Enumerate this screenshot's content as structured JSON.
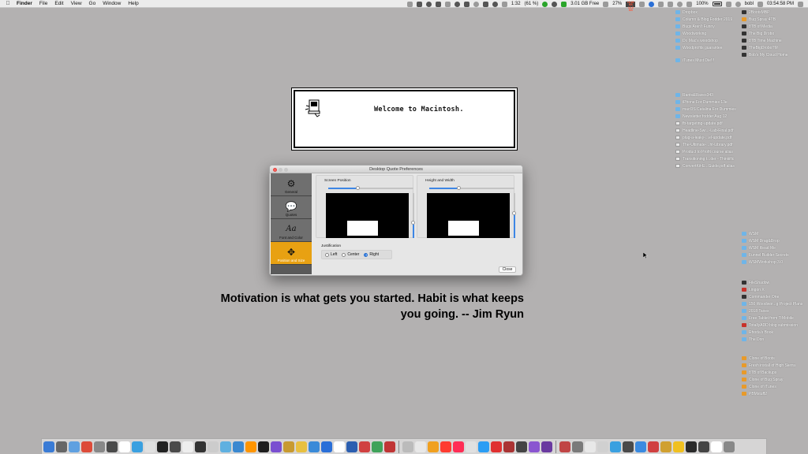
{
  "menubar": {
    "apple": "",
    "app_name": "Finder",
    "items": [
      "File",
      "Edit",
      "View",
      "Go",
      "Window",
      "Help"
    ],
    "status": {
      "time_alt": "1:32",
      "battery_alt": "(61 %)",
      "disk_free": "3.01 GB Free",
      "temp": "27%",
      "battery": "100%",
      "user": "bobl",
      "clock": "03:54:58 PM",
      "netstat": "18.60 KB\n19.5 KB"
    }
  },
  "desktop": {
    "col1_top": [
      {
        "label": "Dropbox",
        "icon": "folder"
      },
      {
        "label": "Column & Blog Fodder 2019",
        "icon": "folder"
      },
      {
        "label": "Bugs Aren't Funny",
        "icon": "folder"
      },
      {
        "label": "Woodworking",
        "icon": "folder"
      },
      {
        "label": "Dr. Mac's woodshop",
        "icon": "folder"
      },
      {
        "label": "Woodprofits guarantee",
        "icon": "folder"
      }
    ],
    "col1_itunes": [
      {
        "label": "iTunes Must Die!!!",
        "icon": "folder"
      }
    ],
    "col1_docs": [
      {
        "label": "Rants&Raves343",
        "icon": "folder"
      },
      {
        "label": "iPhone For Dummies 13e",
        "icon": "folder"
      },
      {
        "label": "macOS Catalina For Dummies",
        "icon": "folder"
      },
      {
        "label": "Newsletter fodder Aug 12",
        "icon": "folder"
      },
      {
        "label": "fb-targeting-update.pdf",
        "icon": "doc"
      },
      {
        "label": "Headline-Swi...-Lab-Final.pdf",
        "icon": "doc"
      },
      {
        "label": "plug-a-leaky-...el-update.pdf",
        "icon": "doc"
      },
      {
        "label": "The-Ultimate-...ht-Library.pdf",
        "icon": "doc"
      },
      {
        "label": "Product to Profit course alias",
        "icon": "doc"
      },
      {
        "label": "Transitioning t...der - Thinkific",
        "icon": "doc"
      },
      {
        "label": "ConvertKit-E...Guide.pdf alias",
        "icon": "doc"
      }
    ],
    "col2_top": [
      {
        "label": "2BootsMBP",
        "icon": "drive"
      },
      {
        "label": "Bug Spray 4TB",
        "icon": "orange"
      },
      {
        "label": "8TB of Media",
        "icon": "drive"
      },
      {
        "label": "The Big Drobo",
        "icon": "drive"
      },
      {
        "label": "8TB Time Machine",
        "icon": "drive"
      },
      {
        "label": "TheBigDroboTM",
        "icon": "drive"
      },
      {
        "label": "Bob's My Cloud Home",
        "icon": "drive"
      }
    ],
    "col2_wsm": [
      {
        "label": "WSM",
        "icon": "folder"
      },
      {
        "label": "WSM Drag&Drop",
        "icon": "folder"
      },
      {
        "label": "WSM Read Me",
        "icon": "folder"
      },
      {
        "label": "Funnel Builder Secrets",
        "icon": "folder"
      },
      {
        "label": "WSMWorkshop 3.0",
        "icon": "folder"
      }
    ],
    "col2_apps": [
      {
        "label": "FileShadow",
        "icon": "drive"
      },
      {
        "label": "Lingon X",
        "icon": "red"
      },
      {
        "label": "Commander One",
        "icon": "drive"
      },
      {
        "label": "150 Woodwor...g Project Plans",
        "icon": "folder"
      },
      {
        "label": "2018 Taxes",
        "icon": "folder"
      },
      {
        "label": "Free Tablet from T-Mobile",
        "icon": "folder"
      },
      {
        "label": "TotallyADD blog submission",
        "icon": "red"
      },
      {
        "label": "Rhoda's Book",
        "icon": "folder"
      },
      {
        "label": "The Don",
        "icon": "folder"
      }
    ],
    "col2_backups": [
      {
        "label": "Clone of Boots",
        "icon": "orange"
      },
      {
        "label": "Fresh install of High Sierra",
        "icon": "orange"
      },
      {
        "label": "8TB of Backups",
        "icon": "orange"
      },
      {
        "label": "Clone of Bug Spray",
        "icon": "orange"
      },
      {
        "label": "Clone of iTunes",
        "icon": "orange"
      },
      {
        "label": "PBMstuff2",
        "icon": "orange"
      }
    ]
  },
  "welcome": {
    "text": "Welcome to Macintosh."
  },
  "prefs": {
    "title": "Desktop Quote Preferences",
    "sidebar": [
      {
        "label": "General",
        "icon": "gear-icon",
        "glyph": "⚙"
      },
      {
        "label": "Quotes",
        "icon": "speech-bubble-icon",
        "glyph": "💬"
      },
      {
        "label": "Font and Color",
        "icon": "font-icon",
        "glyph": "Aa"
      },
      {
        "label": "Position and Size",
        "icon": "move-arrows-icon",
        "glyph": "✥"
      }
    ],
    "screen_position_label": "Screen Position",
    "height_width_label": "Height and Width",
    "screen_h_slider": 0.35,
    "screen_v_slider": 0.35,
    "hw_h_slider": 0.35,
    "hw_v_slider": 0.55,
    "justification_label": "Justification",
    "justification_options": [
      "Left",
      "Center",
      "Right"
    ],
    "justification_selected": "Right",
    "close_label": "Close"
  },
  "quote": {
    "line1": "Motivation is what gets you started. Habit is what keeps",
    "line2": "you going.  --  Jim Ryun"
  },
  "dock": {
    "colors": [
      "#3a7bd5",
      "#666666",
      "#5fa0e0",
      "#dd4b39",
      "#888888",
      "#4a4a4a",
      "#ffffff",
      "#3aa0e0",
      "#e0e0e0",
      "#222222",
      "#4a4a4a",
      "#eeeeee",
      "#333333",
      "#cccccc",
      "#5fb0e0",
      "#3a88d0",
      "#ff9500",
      "#1e1e1e",
      "#7a4fd0",
      "#c89a30",
      "#e8c040",
      "#3a8ad8",
      "#2a6fd8",
      "#ffffff",
      "#2c5fb0",
      "#d04040",
      "#3fa35a",
      "#c03535",
      "#bbbbbb",
      "#e8e8e8",
      "#f0a020",
      "#ff3b30",
      "#ff2d55",
      "#e0e0e0",
      "#2a9df4",
      "#e03030",
      "#aa3333",
      "#444444",
      "#8a55d0",
      "#6a3aa0",
      "#c04545",
      "#7a7a7a",
      "#e8e8e8",
      "#d0d0d0",
      "#3aa0e0",
      "#4a4a4a",
      "#3a8ae0",
      "#d04040",
      "#d0a030",
      "#f0c020",
      "#2a2a2a",
      "#444444",
      "#ffffff",
      "#888888"
    ]
  }
}
